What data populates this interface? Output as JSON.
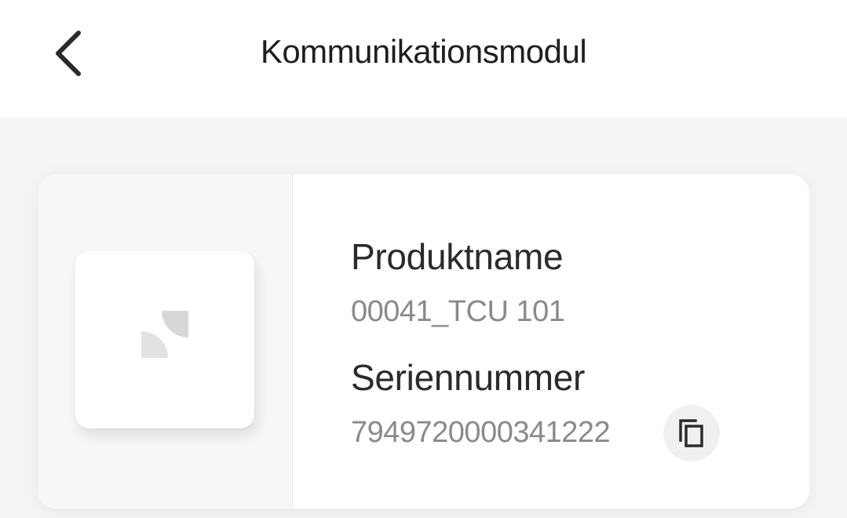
{
  "header": {
    "title": "Kommunikationsmodul",
    "back_icon": "chevron-left-icon"
  },
  "product": {
    "name_label": "Produktname",
    "name_value": "00041_TCU 101",
    "serial_label": "Seriennummer",
    "serial_value": "7949720000341222",
    "copy_icon": "copy-icon"
  },
  "colors": {
    "page_background": "#f5f5f5",
    "card_background": "#ffffff",
    "label_text": "#2b2b2b",
    "value_text": "#8a8a8a"
  }
}
